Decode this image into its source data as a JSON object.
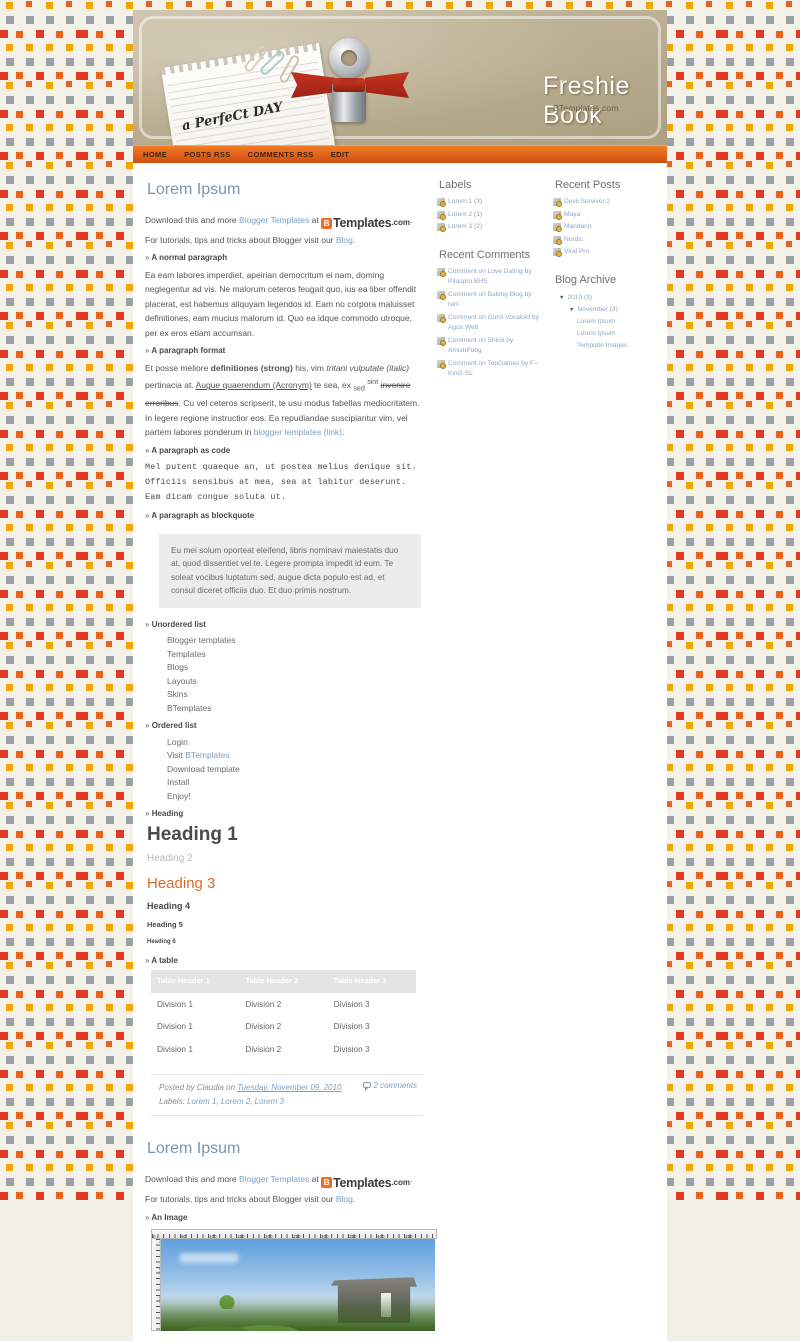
{
  "site": {
    "title": "Freshie Book",
    "subtitle": "BTemplates.com",
    "header_note_text": "a PerfeCt DAY"
  },
  "nav": {
    "items": [
      {
        "label": "HOME"
      },
      {
        "label": "POSTS RSS"
      },
      {
        "label": "COMMENTS RSS"
      },
      {
        "label": "EDIT"
      }
    ]
  },
  "post1": {
    "title": "Lorem Ipsum",
    "intro_line1_pre": "Download this and more ",
    "intro_line1_link": "Blogger Templates",
    "intro_line1_mid": " at ",
    "logo_b": "B",
    "logo_templates": "Templates",
    "logo_dotcom": ".com",
    "intro_line1_end": ".",
    "intro_line2_pre": "For tutorials, tips and tricks about Blogger visit our ",
    "intro_line2_link": "Blog",
    "intro_line2_end": ".",
    "h_normal": "A normal paragraph",
    "normal_text": "Ea eam labores imperdiet, apeirian democritum ei nam, doming neglegentur ad vis. Ne malorum ceteros feugait quo, ius ea liber offendit placerat, est habemus aliquyam legendos id. Eam no corpora maluisset definitiones, eam mucius malorum id. Quo ea idque commodo utroque, per ex eros etiam accumsan.",
    "h_format": "A paragraph format",
    "fmt_a": "Et posse meliore ",
    "fmt_strong": "definitiones (strong)",
    "fmt_b": " his, vim ",
    "fmt_italic": "tritani vulputate (italic)",
    "fmt_c": " pertinacia at. ",
    "fmt_acronym": "Augue quaerendum (Acronym)",
    "fmt_d": " te sea, ex ",
    "fmt_sub": "sed",
    "fmt_sup": "sint",
    "fmt_strike": "invenire erroribus",
    "fmt_e": ". Cu vel ceteros scripserit, te usu modus fabellas mediocritatem. In legere regione instructior eos. Ea repudiandae suscipiantur vim, vel partem labores ponderum in ",
    "fmt_link": "blogger templates (link)",
    "fmt_f": ".",
    "h_code": "A paragraph as code",
    "code_text": "Mel putent quaeque an, ut postea melius denique sit. Officiis sensibus at mea, sea at labitur deserunt. Eam dicam congue soluta ut.",
    "h_blockquote": "A paragraph as blockquote",
    "blockquote_text": "Eu mei solum oporteat eleifend, libris nominavi maiestatis duo at, quod dissentiet vel te. Legere prompta impedit id eum. Te soleat vocibus luptatum sed, augue dicta populo est ad, et consul diceret officiis duo. Et duo primis nostrum.",
    "h_ul": "Unordered list",
    "ul_items": [
      "Blogger templates",
      "Templates",
      "Blogs",
      "Layouts",
      "Skins",
      "BTemplates"
    ],
    "h_ol": "Ordered list",
    "ol_items": [
      {
        "pre": "Login",
        "link": "",
        "post": ""
      },
      {
        "pre": "Visit ",
        "link": "BTemplates",
        "post": ""
      },
      {
        "pre": "Download template",
        "link": "",
        "post": ""
      },
      {
        "pre": "Install",
        "link": "",
        "post": ""
      },
      {
        "pre": "Enjoy!",
        "link": "",
        "post": ""
      }
    ],
    "h_heading": "Heading",
    "h1": "Heading 1",
    "h2": "Heading 2",
    "h3": "Heading 3",
    "h4": "Heading 4",
    "h5": "Heading 5",
    "h6": "Heading 6",
    "h_table": "A table",
    "table": {
      "headers": [
        "Table Header 1",
        "Table Header 2",
        "Table Header 3"
      ],
      "rows": [
        [
          "Division 1",
          "Division 2",
          "Division 3"
        ],
        [
          "Division 1",
          "Division 2",
          "Division 3"
        ],
        [
          "Division 1",
          "Division 2",
          "Division 3"
        ]
      ]
    },
    "footer": {
      "posted_by_pre": "Posted by Claudia on ",
      "date": "Tuesday, November 09, 2010",
      "labels_pre": "Labels: ",
      "labels": [
        "Lorem 1",
        "Lorem 2",
        "Lorem 3"
      ],
      "comments": "2 comments"
    }
  },
  "post2": {
    "title": "Lorem Ipsum",
    "intro_line1_pre": "Download this and more ",
    "intro_line1_link": "Blogger Templates",
    "intro_line1_mid": " at ",
    "logo_b": "B",
    "logo_templates": "Templates",
    "logo_dotcom": ".com",
    "intro_line1_end": ".",
    "intro_line2_pre": "For tutorials, tips and tricks about Blogger visit our ",
    "intro_line2_link": "Blog",
    "intro_line2_end": ".",
    "h_image": "An Image",
    "ruler_top_labels": [
      "0",
      "50",
      "100",
      "150",
      "200",
      "250",
      "300",
      "350",
      "400",
      "450"
    ],
    "ruler_left_labels": [
      "0",
      "50",
      "100",
      "150"
    ]
  },
  "sidebar_a": {
    "labels_title": "Labels",
    "labels": [
      {
        "label": "Lorem 1",
        "count": "(3)"
      },
      {
        "label": "Lorem 2",
        "count": "(1)"
      },
      {
        "label": "Lorem 3",
        "count": "(2)"
      }
    ],
    "comments_title": "Recent Comments",
    "comments": [
      {
        "label": "Comment on Love Dating by Pitaspro BHS"
      },
      {
        "label": "Comment on Baking Blog by rani"
      },
      {
        "label": "Comment on Gumi Vocaloid by Agus Web"
      },
      {
        "label": "Comment on Shiroi by AmishPubg"
      },
      {
        "label": "Comment on TopGames by F--KinG-SL"
      }
    ]
  },
  "sidebar_b": {
    "posts_title": "Recent Posts",
    "posts": [
      {
        "label": "Devil Survivor 2"
      },
      {
        "label": "Maya"
      },
      {
        "label": "Mandarin"
      },
      {
        "label": "Nordic"
      },
      {
        "label": "Viral Pro"
      }
    ],
    "archive_title": "Blog Archive",
    "archive": [
      {
        "level": 1,
        "arrow": "▼",
        "label": "2010 (3)"
      },
      {
        "level": 2,
        "arrow": "▼",
        "label": "November (3)"
      },
      {
        "level": 3,
        "arrow": "",
        "label": "Lorem Ipsum"
      },
      {
        "level": 3,
        "arrow": "",
        "label": "Lorem Ipsum"
      },
      {
        "level": 3,
        "arrow": "",
        "label": "Template Images"
      }
    ]
  },
  "colors": {
    "nav_orange": "#e2611a",
    "heading3_orange": "#e06a22",
    "link_blue": "#7aa0c4",
    "post_title_blue": "#7895ad",
    "pattern_red": "#e03b22",
    "pattern_orange": "#e8631c",
    "pattern_yellow": "#f0a500",
    "pattern_gray": "#9aa0a6"
  }
}
